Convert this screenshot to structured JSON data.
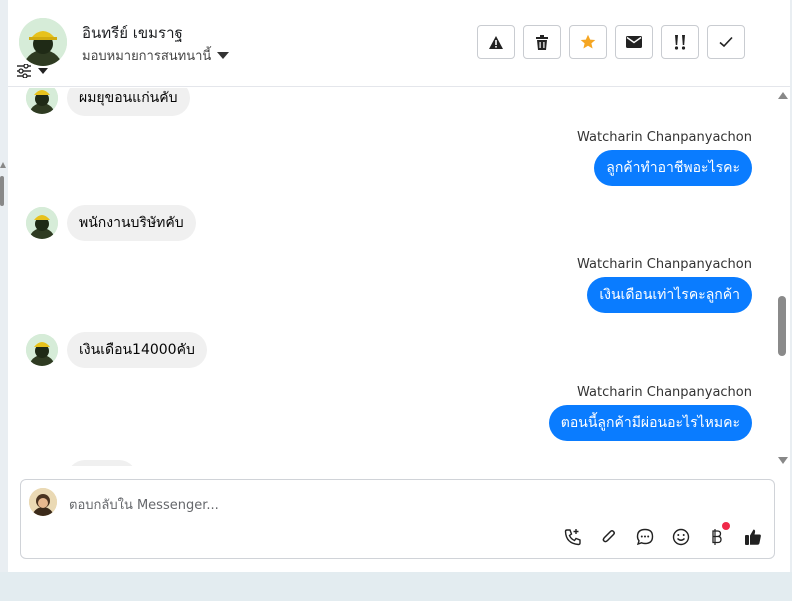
{
  "header": {
    "contact_name": "อินทรีย์ เขมราฐ",
    "assign_label": "มอบหมายการสนทนานี้"
  },
  "toolbar": {
    "buttons": [
      {
        "icon": "warning-icon",
        "label": "spam"
      },
      {
        "icon": "trash-icon",
        "label": "delete"
      },
      {
        "icon": "star-icon",
        "label": "star",
        "color": "#f5a623"
      },
      {
        "icon": "envelope-icon",
        "label": "mark unread"
      },
      {
        "icon": "follow-up-icon",
        "label": "follow up"
      },
      {
        "icon": "check-icon",
        "label": "done"
      }
    ]
  },
  "messages": [
    {
      "direction": "in",
      "text": "ผมยุขอนแก่นคับ"
    },
    {
      "direction": "out",
      "sender": "Watcharin Chanpanyachon",
      "text": "ลูกค้าทำอาชีพอะไรคะ"
    },
    {
      "direction": "in",
      "text": "พนักงานบริษัทคับ"
    },
    {
      "direction": "out",
      "sender": "Watcharin Chanpanyachon",
      "text": "เงินเดือนเท่าไรคะลูกค้า"
    },
    {
      "direction": "in",
      "text": "เงินเดือน14000คับ"
    },
    {
      "direction": "out",
      "sender": "Watcharin Chanpanyachon",
      "text": "ตอนนี้ลูกค้ามีผ่อนอะไรไหมคะ"
    }
  ],
  "composer": {
    "placeholder": "ตอบกลับใน Messenger...",
    "icons": [
      "phone-icon",
      "paperclip-icon",
      "chat-bubble-icon",
      "emoji-icon",
      "baht-icon",
      "thumbs-up-icon"
    ]
  },
  "colors": {
    "accent": "#0a7cff",
    "incoming_bubble": "#f0f0f0",
    "star": "#f5a623",
    "notification_dot": "#f02849"
  }
}
